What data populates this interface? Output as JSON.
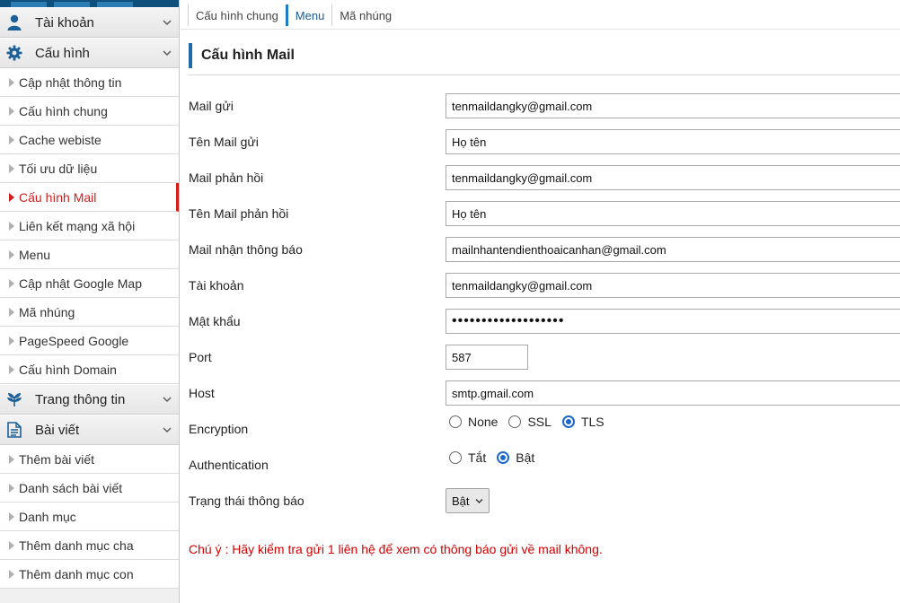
{
  "sidebar": {
    "sections": [
      {
        "label": "Tài khoản",
        "icon": "user-icon"
      },
      {
        "label": "Cấu hình",
        "icon": "gear-icon",
        "items": [
          "Cập nhật thông tin",
          "Cấu hình chung",
          "Cache webiste",
          "Tối ưu dữ liệu",
          "Cấu hình Mail",
          "Liên kết mạng xã hội",
          "Menu",
          "Cập nhật Google Map",
          "Mã nhúng",
          "PageSpeed Google",
          "Cấu hình Domain"
        ]
      },
      {
        "label": "Trang thông tin",
        "icon": "leaf-icon"
      },
      {
        "label": "Bài viết",
        "icon": "document-icon",
        "items": [
          "Thêm bài viết",
          "Danh sách bài viết",
          "Danh mục",
          "Thêm danh mục cha",
          "Thêm danh mục con"
        ]
      }
    ],
    "active_item": "Cấu hình Mail"
  },
  "tabs": [
    "Cấu hình chung",
    "Menu",
    "Mã nhúng"
  ],
  "active_tab": "Menu",
  "page_title": "Cấu hình Mail",
  "form": {
    "mail_gui": {
      "label": "Mail gửi",
      "value": "tenmaildangky@gmail.com"
    },
    "ten_mail_gui": {
      "label": "Tên Mail gửi",
      "value": "Họ tên"
    },
    "mail_phan_hoi": {
      "label": "Mail phản hồi",
      "value": "tenmaildangky@gmail.com"
    },
    "ten_mail_phan_hoi": {
      "label": "Tên Mail phản hồi",
      "value": "Họ tên"
    },
    "mail_nhan_thong_bao": {
      "label": "Mail nhận thông báo",
      "value": "mailnhantendienthoaicanhan@gmail.com"
    },
    "tai_khoan": {
      "label": "Tài khoản",
      "value": "tenmaildangky@gmail.com"
    },
    "mat_khau": {
      "label": "Mật khẩu",
      "value": "•••••••••••••••••••"
    },
    "port": {
      "label": "Port",
      "value": "587"
    },
    "host": {
      "label": "Host",
      "value": "smtp.gmail.com"
    },
    "encryption": {
      "label": "Encryption",
      "options": [
        "None",
        "SSL",
        "TLS"
      ],
      "selected": "TLS"
    },
    "authentication": {
      "label": "Authentication",
      "options": [
        "Tắt",
        "Bật"
      ],
      "selected": "Bật"
    },
    "trang_thai": {
      "label": "Trạng thái thông báo",
      "value": "Bật"
    }
  },
  "note": "Chú ý : Hãy kiểm tra gửi 1 liên hệ để xem có thông báo gửi về mail không.",
  "colors": {
    "accent": "#1e6aab",
    "active": "#d31d1d",
    "note": "#d00000"
  }
}
